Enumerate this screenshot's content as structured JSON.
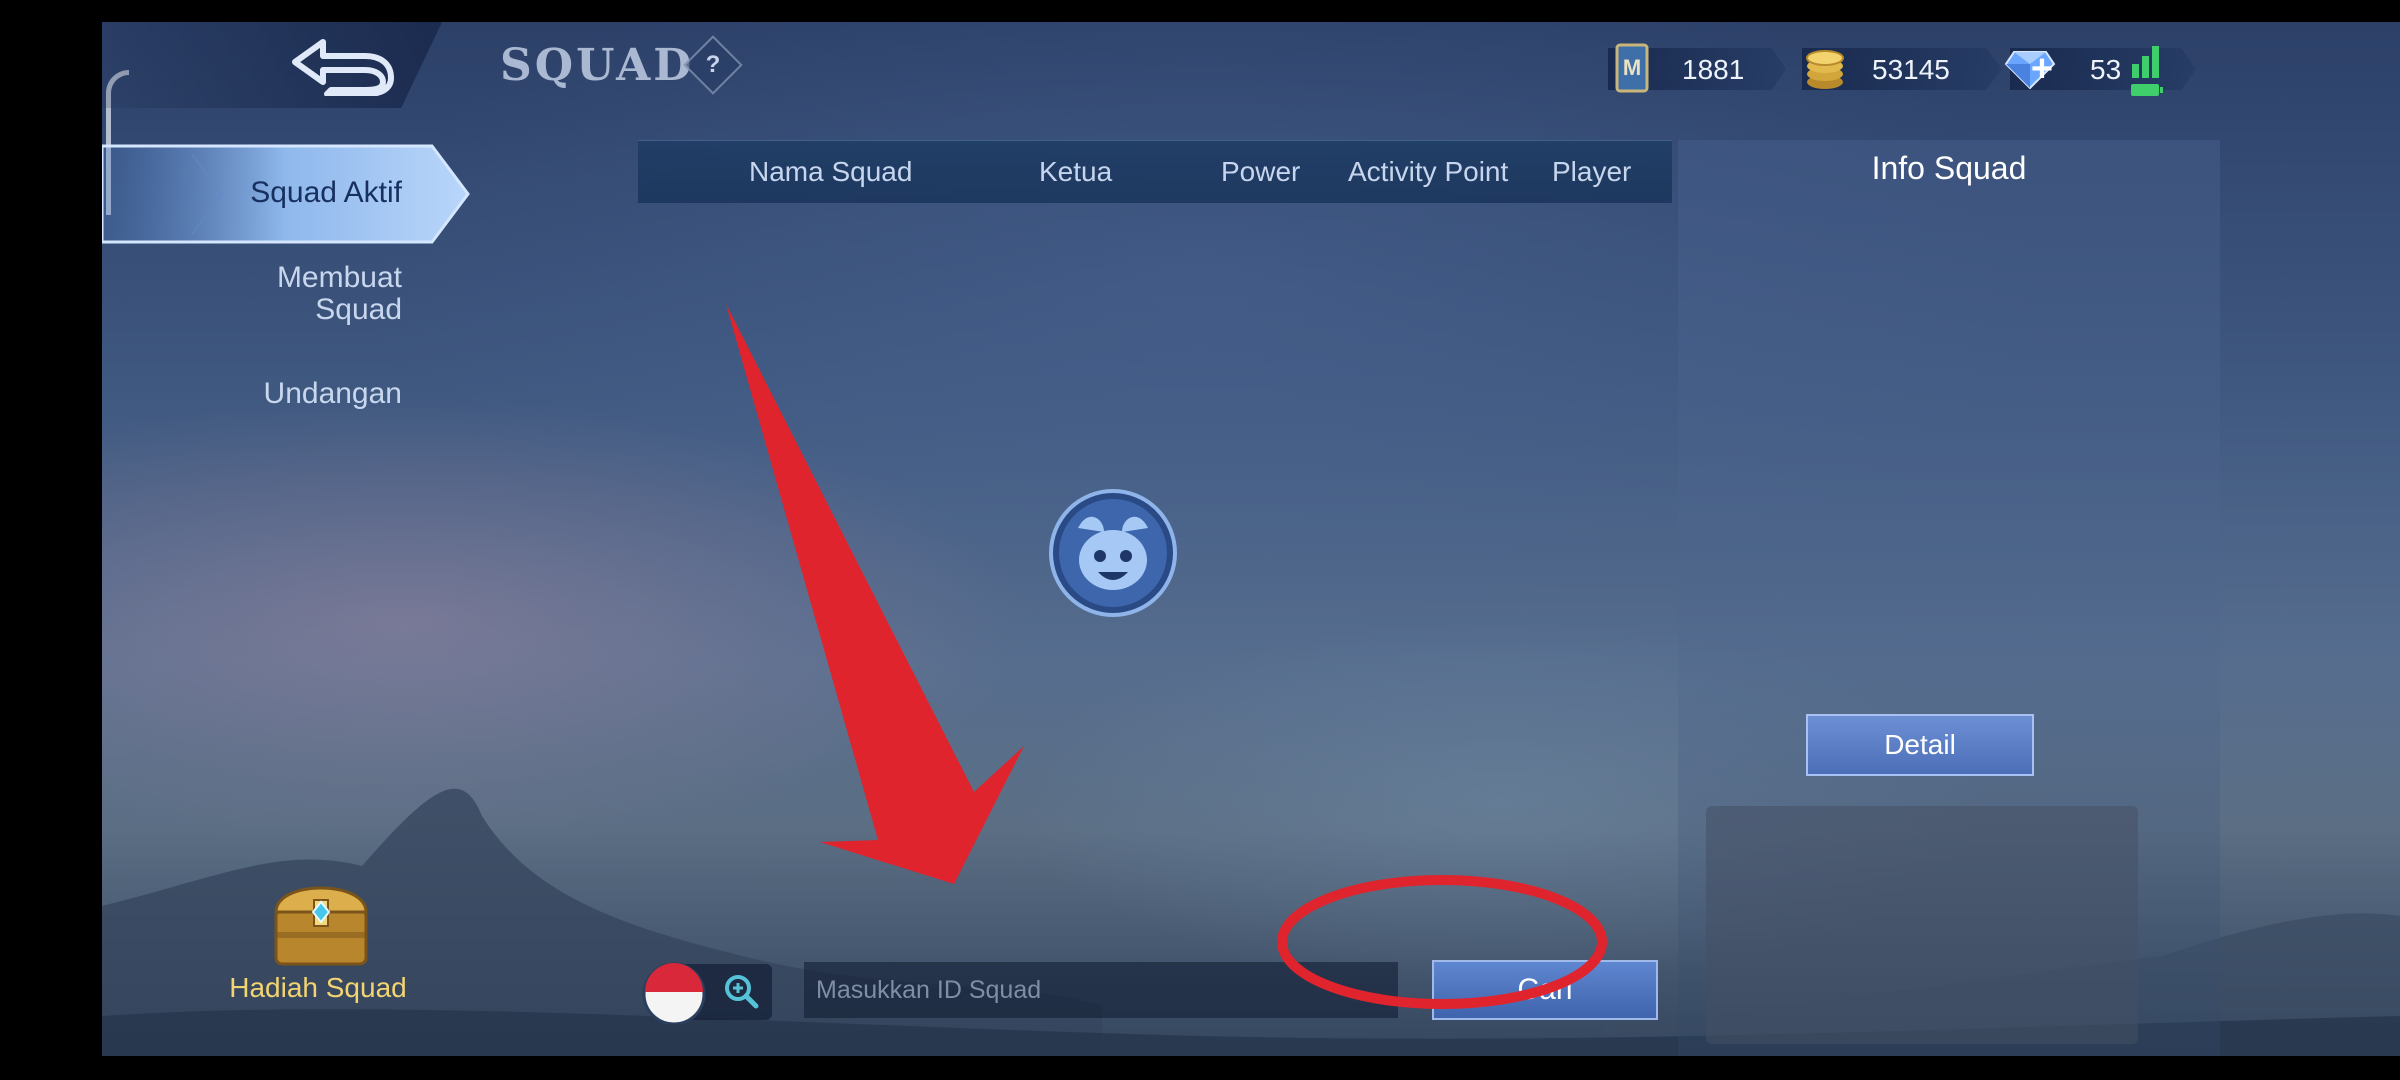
{
  "header": {
    "title": "SQUAD",
    "help_label": "?"
  },
  "currencies": [
    {
      "name": "ticket",
      "icon": "m-ticket-icon",
      "value": "1881"
    },
    {
      "name": "battle-points",
      "icon": "gold-coins-icon",
      "value": "53145"
    },
    {
      "name": "diamonds",
      "icon": "diamond-icon",
      "value": "53"
    }
  ],
  "plus_label": "+",
  "nav": {
    "active": "Squad Aktif",
    "create": "Membuat Squad",
    "invites": "Undangan"
  },
  "reward": {
    "label": "Hadiah Squad"
  },
  "table": {
    "columns": [
      "Nama Squad",
      "Ketua",
      "Power",
      "Activity Point",
      "Player"
    ]
  },
  "info": {
    "title": "Info Squad",
    "detail_label": "Detail"
  },
  "search": {
    "placeholder": "Masukkan ID Squad",
    "value": "",
    "button_label": "Cari"
  },
  "colors": {
    "accent_blue": "#4c6fb8",
    "reward_gold": "#f2d472",
    "annotation_red": "#e0242e"
  }
}
